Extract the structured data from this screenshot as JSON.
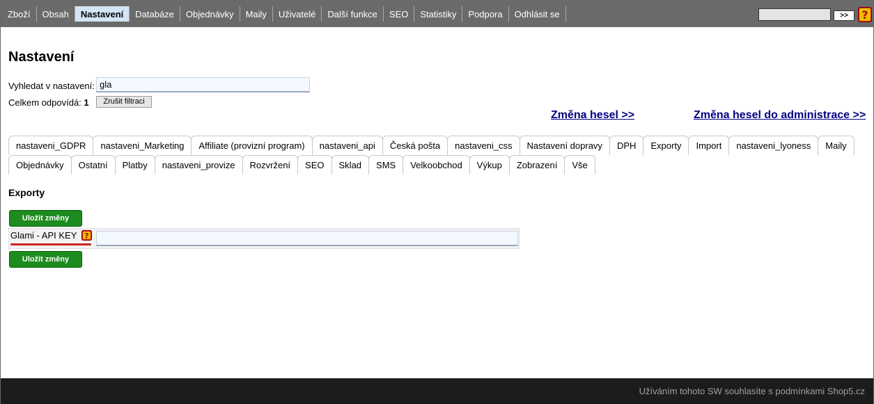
{
  "nav": {
    "items": [
      {
        "label": "Zboží",
        "active": false
      },
      {
        "label": "Obsah",
        "active": false
      },
      {
        "label": "Nastavení",
        "active": true
      },
      {
        "label": "Databáze",
        "active": false
      },
      {
        "label": "Objednávky",
        "active": false
      },
      {
        "label": "Maily",
        "active": false
      },
      {
        "label": "Uživatelé",
        "active": false
      },
      {
        "label": "Další funkce",
        "active": false
      },
      {
        "label": "SEO",
        "active": false
      },
      {
        "label": "Statistiky",
        "active": false
      },
      {
        "label": "Podpora",
        "active": false
      },
      {
        "label": "Odhlásit se",
        "active": false
      }
    ],
    "search_value": "",
    "go_label": ">>",
    "help_icon": "help-icon"
  },
  "page": {
    "title": "Nastavení",
    "search_label": "Vyhledat v nastavení:",
    "search_value": "gla",
    "count_label": "Celkem odpovídá:",
    "count_value": "1",
    "clear_label": "Zrušit filtraci",
    "link_passwords": "Změna hesel >>",
    "link_admin_passwords": "Změna hesel do administrace >>"
  },
  "tabs": {
    "row1": [
      "nastaveni_GDPR",
      "nastaveni_Marketing",
      "Affiliate (provizní program)",
      "nastaveni_api",
      "Česká pošta",
      "nastaveni_css",
      "Nastavení dopravy",
      "DPH",
      "Exporty",
      "Import",
      "nastaveni_lyoness",
      "Maily"
    ],
    "row2": [
      "Objednávky",
      "Ostatní",
      "Platby",
      "nastaveni_provize",
      "Rozvržení",
      "SEO",
      "Sklad",
      "SMS",
      "Velkoobchod",
      "Výkup",
      "Zobrazení",
      "Vše"
    ]
  },
  "section": {
    "title": "Exporty",
    "save_label": "Uložit změny",
    "field_label": "Glami - API KEY",
    "field_value": ""
  },
  "footer": {
    "text": "Užíváním tohoto SW souhlasíte s podmínkami Shop5.cz"
  },
  "colors": {
    "topbar": "#6a6a6a",
    "active_nav": "#d2e4f5",
    "save_button": "#1d8b1d",
    "link": "#000080",
    "footer": "#1c1c1c"
  }
}
